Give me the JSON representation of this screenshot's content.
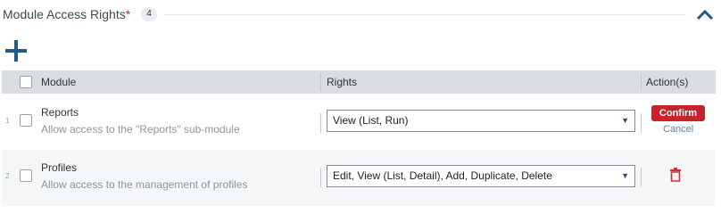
{
  "section": {
    "title": "Module Access Rights",
    "required_mark": "*",
    "count": "4"
  },
  "icons": {
    "collapse": "chevron-up-icon",
    "add": "plus-icon",
    "delete": "trash-icon",
    "dropdown": "triangle-down-icon"
  },
  "colors": {
    "accent": "#1f5a8a",
    "required": "#d0312d",
    "confirm": "#c8232c",
    "delete": "#d0312d",
    "header_bg": "#d9dde2"
  },
  "table": {
    "columns": [
      "Module",
      "Rights",
      "Action(s)"
    ],
    "rows": [
      {
        "num": "1",
        "module": "Reports",
        "description": "Allow access to the \"Reports\" sub-module",
        "rights": "View (List, Run)",
        "confirm_label": "Confirm",
        "cancel_label": "Cancel"
      },
      {
        "num": "2",
        "module": "Profiles",
        "description": "Allow access to the management of profiles",
        "rights": "Edit, View (List, Detail), Add, Duplicate, Delete"
      }
    ]
  }
}
